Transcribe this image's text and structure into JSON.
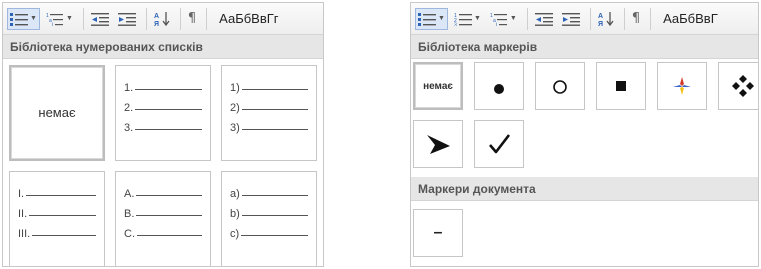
{
  "left_panel": {
    "style_preview": "АаБбВвГг",
    "section_title": "Бібліотека нумерованих списків",
    "none_label": "немає",
    "tiles": [
      {
        "lines": [
          "1.",
          "2.",
          "3."
        ]
      },
      {
        "lines": [
          "1)",
          "2)",
          "3)"
        ]
      },
      {
        "lines": [
          "I.",
          "II.",
          "III."
        ]
      },
      {
        "lines": [
          "A.",
          "B.",
          "C."
        ]
      },
      {
        "lines": [
          "a)",
          "b)",
          "c)"
        ]
      }
    ]
  },
  "right_panel": {
    "style_preview": "АаБбВвГ",
    "bullet_library_title": "Бібліотека маркерів",
    "none_label": "немає",
    "document_markers_title": "Маркери документа",
    "document_marker": "–"
  },
  "colors": {
    "toolbar_active": "#dbe7f7",
    "bullet_icon_blue": "#2e63b8",
    "star_red": "#d23a2a",
    "star_blue": "#3b62c8",
    "star_yellow": "#f3c21b"
  }
}
